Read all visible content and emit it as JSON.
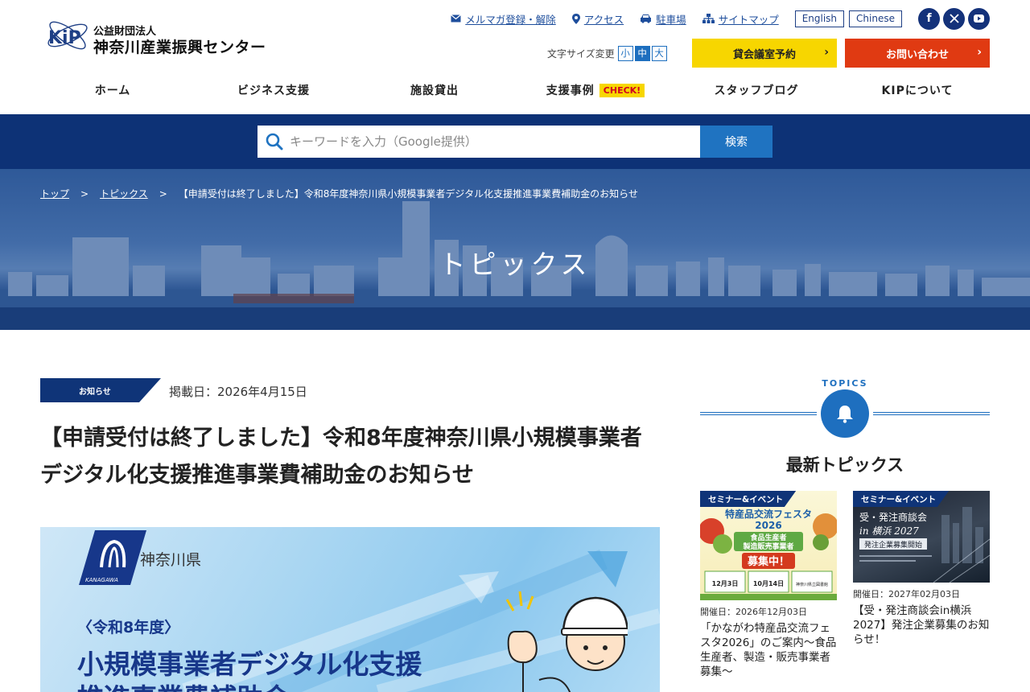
{
  "header": {
    "logo_sub": "公益財団法人",
    "logo_main": "神奈川産業振興センター",
    "logo_mark_text": "KiP",
    "util_links": [
      {
        "label": "メルマガ登録・解除",
        "icon": "mail-icon"
      },
      {
        "label": "アクセス",
        "icon": "location-pin-icon"
      },
      {
        "label": "駐車場",
        "icon": "car-icon"
      },
      {
        "label": "サイトマップ",
        "icon": "sitemap-icon"
      }
    ],
    "languages": [
      "English",
      "Chinese"
    ],
    "sns": [
      {
        "name": "facebook-icon",
        "glyph": "f"
      },
      {
        "name": "x-icon",
        "glyph": "𝕏"
      },
      {
        "name": "youtube-icon",
        "glyph": "▶"
      }
    ],
    "font_size_label": "文字サイズ変更",
    "font_sizes": [
      "小",
      "中",
      "大"
    ],
    "font_size_active": "中",
    "cta_rent": "貸会議室予約",
    "cta_contact": "お問い合わせ",
    "cta_arrow": "›"
  },
  "nav": {
    "items": [
      "ホーム",
      "ビジネス支援",
      "施設貸出",
      "支援事例",
      "スタッフブログ",
      "KIPについて"
    ],
    "check_badge": "CHECK!"
  },
  "search": {
    "placeholder": "キーワードを入力（Google提供）",
    "button": "検索"
  },
  "hero": {
    "breadcrumb": [
      "トップ",
      "トピックス",
      "【申請受付は終了しました】令和8年度神奈川県小規模事業者デジタル化支援推進事業費補助金のお知らせ"
    ],
    "separator": ">",
    "title": "トピックス"
  },
  "article": {
    "category": "お知らせ",
    "date": "掲載日：2026年4月15日",
    "title": "【申請受付は終了しました】令和8年度神奈川県小規模事業者デジタル化支援推進事業費補助金のお知らせ",
    "banner": {
      "pref_name": "神奈川県",
      "pref_logo_text": "KANAGAWA",
      "year": "〈令和8年度〉",
      "title_line1": "小規模事業者デジタル化支援",
      "title_line2": "推進事業費補助金"
    }
  },
  "sidebar": {
    "topics_label": "TOPICS",
    "title": "最新トピックス",
    "cards": [
      {
        "category": "セミナー&イベント",
        "date": "開催日：2026年12月03日",
        "title": "「かながわ特産品交流フェスタ2026」のご案内～食品生産者、製造・販売事業者募集～",
        "img_line1": "特産品交流フェスタ",
        "img_line2": "2026",
        "img_line3": "食品生産者",
        "img_line4": "製造販売事業者",
        "img_line5": "募集中！",
        "img_dates": [
          "12月3日",
          "10月14日",
          "神奈川県立図書館"
        ]
      },
      {
        "category": "セミナー&イベント",
        "date": "開催日：2027年02月03日",
        "title": "【受・発注商談会in横浜2027】発注企業募集のお知らせ！",
        "img_line1": "受・発注商談会",
        "img_line2": "in 横浜 2027",
        "img_line3": "発注企業募集開始"
      }
    ]
  }
}
